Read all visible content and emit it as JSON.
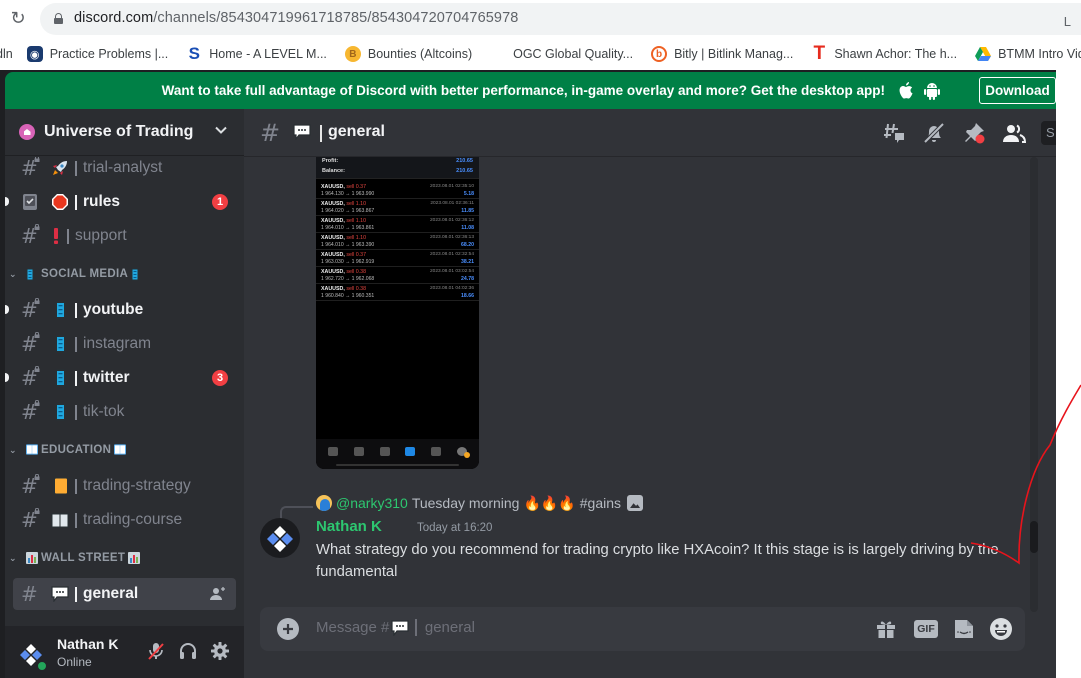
{
  "browser": {
    "url_host": "discord.com",
    "url_path": "/channels/854304719961718785/854304720704765978",
    "right_text": "L",
    "bookmarks": [
      {
        "label": "dln",
        "icon": "linkedin-fragment"
      },
      {
        "label": "Practice Problems |...",
        "icon": "shield-crest-icon",
        "color": "#1a3a6e"
      },
      {
        "label": "Home - A LEVEL M...",
        "icon": "s-logo-icon",
        "color": "#1a4fb5"
      },
      {
        "label": "Bounties (Altcoins)",
        "icon": "bitcoin-icon",
        "color": "#f7b731"
      },
      {
        "label": "OGC Global Quality...",
        "icon": "microsoft-logo-icon"
      },
      {
        "label": "Bitly | Bitlink Manag...",
        "icon": "bitly-icon",
        "color": "#ee6123"
      },
      {
        "label": "Shawn Achor: The h...",
        "icon": "ted-t-icon",
        "color": "#e62b1e"
      },
      {
        "label": "BTMM Intro Videos",
        "icon": "google-drive-icon"
      }
    ]
  },
  "banner": {
    "text": "Want to take full advantage of Discord with better performance, in-game overlay and more? Get the desktop app!",
    "download_label": "Download",
    "color": "#008046"
  },
  "server": {
    "name": "Universe of Trading"
  },
  "sidebar": {
    "channels": [
      {
        "id": "trial-analyst",
        "emoji": "rocket",
        "label": "trial-analyst",
        "locked": true,
        "unread": false
      },
      {
        "id": "rules",
        "emoji": "stop-sign",
        "label": "rules",
        "locked": false,
        "type": "rules",
        "unread": true,
        "badge": "1"
      },
      {
        "id": "support",
        "emoji": "exclamation",
        "label": "support",
        "locked": true,
        "unread": false
      }
    ],
    "categories": [
      {
        "name": "SOCIAL MEDIA",
        "emoji": "mobile-phone",
        "channels": [
          {
            "emoji": "mobile-phone",
            "label": "youtube",
            "locked": true,
            "unread": true
          },
          {
            "emoji": "mobile-phone",
            "label": "instagram",
            "locked": true,
            "unread": false
          },
          {
            "emoji": "mobile-phone",
            "label": "twitter",
            "locked": true,
            "unread": true,
            "badge": "3"
          },
          {
            "emoji": "mobile-phone",
            "label": "tik-tok",
            "locked": true,
            "unread": false
          }
        ]
      },
      {
        "name": "EDUCATION",
        "emoji": "open-book",
        "channels": [
          {
            "emoji": "ledger",
            "label": "trading-strategy",
            "locked": true,
            "unread": false
          },
          {
            "emoji": "open-book",
            "label": "trading-course",
            "locked": true,
            "unread": false
          }
        ]
      },
      {
        "name": "WALL STREET",
        "emoji": "bar-chart",
        "channels": [
          {
            "emoji": "speech-balloon",
            "label": "general",
            "locked": false,
            "active": true
          }
        ]
      }
    ]
  },
  "user": {
    "name": "Nathan K",
    "status": "Online",
    "mic_muted": true
  },
  "channel_header": {
    "name": "general",
    "search_placeholder": "S"
  },
  "attachment": {
    "summary": [
      {
        "label": "Profit:",
        "value": "210.65"
      },
      {
        "label": "Balance:",
        "value": "210.65"
      }
    ],
    "trades": [
      {
        "symbol": "XAUUSD,",
        "action": "sell 0.37",
        "prices": "1 964.130 → 1 963.990",
        "datetime": "2023.08.01 02:35:10",
        "profit": "5.18"
      },
      {
        "symbol": "XAUUSD,",
        "action": "sell 1.10",
        "prices": "1 964.020 → 1 963.867",
        "datetime": "2023.08.01 02:36:11",
        "profit": "11.85"
      },
      {
        "symbol": "XAUUSD,",
        "action": "sell 1.10",
        "prices": "1 964.010 → 1 963.861",
        "datetime": "2023.08.01 02:36:12",
        "profit": "11.08"
      },
      {
        "symbol": "XAUUSD,",
        "action": "sell 1.10",
        "prices": "1 964.010 → 1 963.390",
        "datetime": "2023.08.01 02:36:13",
        "profit": "68.20"
      },
      {
        "symbol": "XAUUSD,",
        "action": "sell 0.37",
        "prices": "1 963.030 → 1 962.919",
        "datetime": "2023.08.01 02:32:54",
        "profit": "38.21"
      },
      {
        "symbol": "XAUUSD,",
        "action": "sell 0.38",
        "prices": "1 962.720 → 1 962.068",
        "datetime": "2023.08.01 03:02:54",
        "profit": "24.78"
      },
      {
        "symbol": "XAUUSD,",
        "action": "sell 0.38",
        "prices": "1 960.840 → 1 960.351",
        "datetime": "2023.08.01 04:02:36",
        "profit": "18.66"
      }
    ]
  },
  "message": {
    "reply": {
      "author": "@narky310",
      "text": "Tuesday morning",
      "emojis": "🔥🔥🔥",
      "tag": "#gains"
    },
    "author": "Nathan K",
    "timestamp": "Today at 16:20",
    "body": "What strategy do you recommend for trading crypto like HXAcoin? It this stage is is largely driving by the fundamental",
    "author_color": "#2dc770"
  },
  "composer": {
    "placeholder_prefix": "Message #",
    "placeholder_channel": "general",
    "gif_label": "GIF"
  }
}
